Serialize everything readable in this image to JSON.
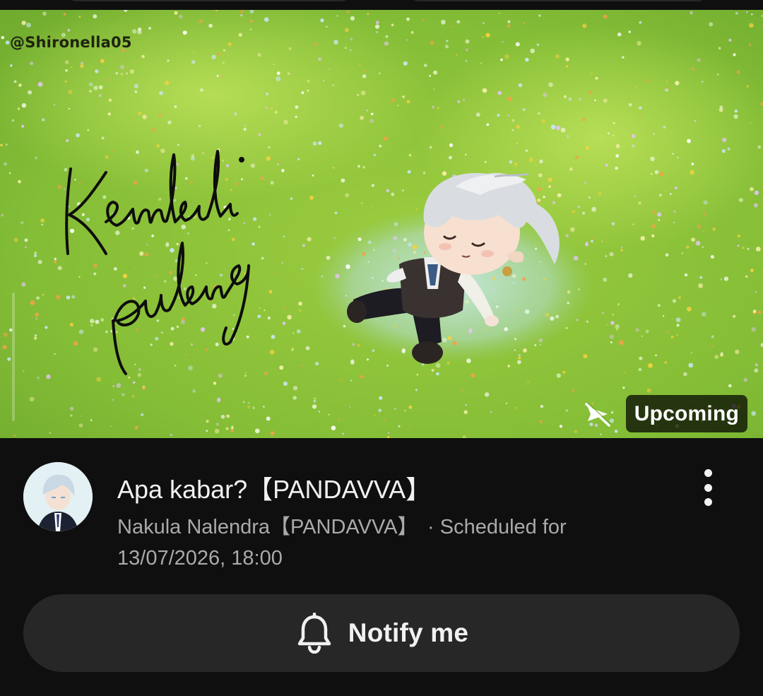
{
  "thumbnail": {
    "watermark": "@Shironella05",
    "script_text": "Kembali pulang",
    "status_badge": "Upcoming",
    "notifications_icon": "notifications-off-icon",
    "palette": {
      "grass_light": "#b5d94a",
      "grass_mid": "#8cc63f",
      "grass_dark": "#5f9a2a"
    }
  },
  "video": {
    "title": "Apa kabar?【PANDAVVA】",
    "channel": "Nakula Nalendra【PANDAVVA】",
    "separator": "·",
    "schedule_prefix": "Scheduled for",
    "schedule_datetime": "13/07/2026, 18:00",
    "more_icon": "more-vert-icon",
    "avatar_icon": "channel-avatar"
  },
  "notify": {
    "label": "Notify me",
    "icon": "bell-icon",
    "bg_color": "#272727"
  },
  "theme": {
    "background": "#0f0f0f",
    "text_primary": "#f1f1f1",
    "text_secondary": "#aaaaaa"
  }
}
